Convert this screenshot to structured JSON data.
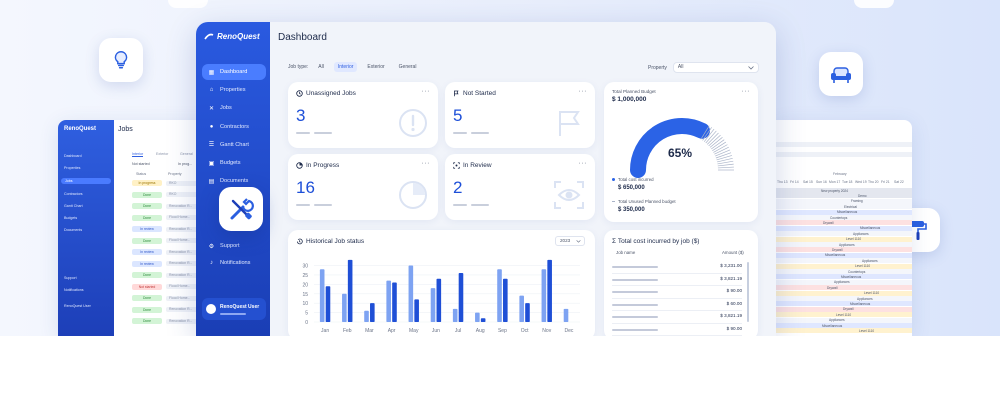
{
  "left_window": {
    "logo": "RenoQuest",
    "title": "Jobs",
    "nav": [
      "Dashboard",
      "Properties",
      "Jobs",
      "Contractors",
      "Gantt Chart",
      "Budgets",
      "Documents",
      "Support",
      "Notifications",
      "RenoQuest User"
    ],
    "tabs": [
      "Interior",
      "Exterior",
      "General"
    ],
    "group_not_started": "Not started",
    "group_in_progress": "In prog...",
    "col_status": "Status",
    "col_property": "Property",
    "status_rows": [
      {
        "status": "In progress",
        "kind": "prog",
        "prop": "RKO"
      },
      {
        "status": "Done",
        "kind": "done",
        "prop": "RKO"
      },
      {
        "status": "Done",
        "kind": "done",
        "prop": "Renovation R..."
      },
      {
        "status": "Done",
        "kind": "done",
        "prop": "Flood Home..."
      },
      {
        "status": "In review",
        "kind": "rev",
        "prop": "Renovation R..."
      },
      {
        "status": "Done",
        "kind": "done",
        "prop": "Flood Home..."
      },
      {
        "status": "In review",
        "kind": "rev",
        "prop": "Renovation R..."
      },
      {
        "status": "In review",
        "kind": "rev",
        "prop": "Renovation R..."
      },
      {
        "status": "Done",
        "kind": "done",
        "prop": "Renovation R..."
      },
      {
        "status": "Not started",
        "kind": "ns",
        "prop": "Flood Home..."
      },
      {
        "status": "Done",
        "kind": "done",
        "prop": "Flood Home..."
      },
      {
        "status": "Done",
        "kind": "done",
        "prop": "Renovation R..."
      },
      {
        "status": "Done",
        "kind": "done",
        "prop": "Renovation R..."
      }
    ]
  },
  "right_window": {
    "month": "February",
    "days": [
      "Thu 13",
      "Fri 14",
      "Sat 15",
      "Sun 16",
      "Mon 17",
      "Tue 18",
      "Wed 19",
      "Thu 20",
      "Fri 21",
      "Sat 22"
    ],
    "rows": [
      {
        "label": "New property 2024",
        "color": "#e4e7ef"
      },
      {
        "label": "Demo",
        "color": "#e4e7ef"
      },
      {
        "label": "Framing",
        "color": "#f4f6fb"
      },
      {
        "label": "Electrical",
        "color": "#f4f6fb"
      },
      {
        "label": "Miscellaneous",
        "color": "#dfe7ff"
      },
      {
        "label": "Countertops",
        "color": "#f4f6fb"
      },
      {
        "label": "Drywall",
        "color": "#fde1e1"
      },
      {
        "label": "Miscellaneous",
        "color": "#dfe7ff"
      },
      {
        "label": "Appliances",
        "color": "#f4f6fb"
      },
      {
        "label": "Level 1110",
        "color": "#fff2cf"
      },
      {
        "label": "Appliances",
        "color": "#f4f6fb"
      },
      {
        "label": "Drywall",
        "color": "#fde1e1"
      },
      {
        "label": "Miscellaneous",
        "color": "#dfe7ff"
      },
      {
        "label": "Appliances",
        "color": "#f4f6fb"
      },
      {
        "label": "Level 1110",
        "color": "#fff2cf"
      },
      {
        "label": "Countertops",
        "color": "#f4f6fb"
      },
      {
        "label": "Miscellaneous",
        "color": "#dfe7ff"
      },
      {
        "label": "Appliances",
        "color": "#f4f6fb"
      },
      {
        "label": "Drywall",
        "color": "#fde1e1"
      },
      {
        "label": "Level 1110",
        "color": "#fff2cf"
      },
      {
        "label": "Appliances",
        "color": "#f4f6fb"
      },
      {
        "label": "Miscellaneous",
        "color": "#dfe7ff"
      },
      {
        "label": "Drywall",
        "color": "#fde1e1"
      },
      {
        "label": "Level 1110",
        "color": "#fff2cf"
      },
      {
        "label": "Appliances",
        "color": "#f4f6fb"
      },
      {
        "label": "Miscellaneous",
        "color": "#dfe7ff"
      },
      {
        "label": "Level 1110",
        "color": "#fff2cf"
      }
    ]
  },
  "main": {
    "logo": "RenoQuest",
    "title": "Dashboard",
    "sidebar": [
      {
        "label": "Dashboard",
        "icon": "grid-icon",
        "active": true
      },
      {
        "label": "Properties",
        "icon": "home-icon",
        "active": false
      },
      {
        "label": "Jobs",
        "icon": "tools-icon",
        "active": false
      },
      {
        "label": "Contractors",
        "icon": "person-icon",
        "active": false
      },
      {
        "label": "Gantt Chart",
        "icon": "gantt-icon",
        "active": false
      },
      {
        "label": "Budgets",
        "icon": "wallet-icon",
        "active": false
      },
      {
        "label": "Documents",
        "icon": "document-icon",
        "active": false
      }
    ],
    "sidebar_bottom": [
      {
        "label": "Support",
        "icon": "gear-icon"
      },
      {
        "label": "Notifications",
        "icon": "bell-icon"
      }
    ],
    "user": "RenoQuest User",
    "filters": {
      "label": "Job type:",
      "options": [
        "All",
        "Interior",
        "Exterior",
        "General"
      ],
      "active": "Interior"
    },
    "property": {
      "label": "Property",
      "value": "All"
    },
    "cards": {
      "unassigned": {
        "title": "Unassigned Jobs",
        "value": "3"
      },
      "not_started": {
        "title": "Not Started",
        "value": "5"
      },
      "in_progress": {
        "title": "In Progress",
        "value": "16"
      },
      "in_review": {
        "title": "In Review",
        "value": "2"
      },
      "more": "···"
    },
    "budget": {
      "title": "Total Planned Budget",
      "total": "$ 1,000,000",
      "percent": 65,
      "percent_label": "65%",
      "incurred_label": "Total cost incurred",
      "incurred": "$ 650,000",
      "unused_label": "Total Unused Planned budget",
      "unused": "$ 350,000",
      "colors": {
        "used": "#2b63e6",
        "unused": "#a9b3c8"
      }
    },
    "history": {
      "title": "Historical Job status",
      "year": "2023",
      "colors": {
        "light": "#7ea3f2",
        "dark": "#1f4fd6"
      }
    },
    "costs": {
      "title": "Total cost incurred by job ($)",
      "col_job": "Job name",
      "col_amount": "Amount ($)",
      "amounts": [
        "$ 3,231.00",
        "$ 3,821.19",
        "$ 90.00",
        "$ 60.00",
        "$ 3,821.19",
        "$ 90.00"
      ]
    }
  },
  "chart_data": {
    "type": "bar",
    "title": "Historical Job status",
    "categories": [
      "Jan",
      "Feb",
      "Mar",
      "Apr",
      "May",
      "Jun",
      "Jul",
      "Aug",
      "Sep",
      "Oct",
      "Nov",
      "Dec"
    ],
    "series": [
      {
        "values": [
          28,
          15,
          6,
          22,
          30,
          18,
          7,
          5,
          28,
          14,
          28,
          7
        ]
      },
      {
        "values": [
          19,
          33,
          10,
          21,
          12,
          23,
          26,
          2,
          23,
          10,
          33,
          0
        ]
      }
    ],
    "yticks": [
      0,
      5,
      10,
      15,
      20,
      25,
      30
    ],
    "ylim": [
      0,
      34
    ],
    "grid": true
  }
}
